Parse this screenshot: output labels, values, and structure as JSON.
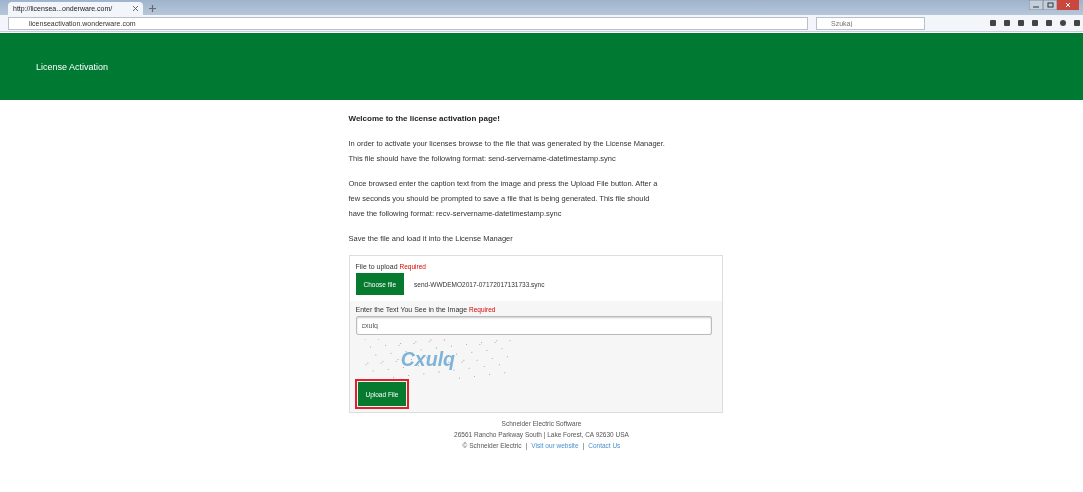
{
  "browser": {
    "tab": {
      "title": "http://licensea...onderware.com/",
      "selected": true
    },
    "url": "licenseactivation.wonderware.com",
    "search": {
      "placeholder": "Szukaj"
    }
  },
  "header": {
    "title": "License Activation"
  },
  "content": {
    "heading": "Welcome to the license activation page!",
    "paragraphs": [
      [
        "In order to activate your licenses browse to the file that was generated by the License Manager.",
        "This file should have the following format: send-servername-datetimestamp.sync"
      ],
      [
        "Once browsed enter the caption text from the image and press the Upload File button. After a",
        "few seconds you should be prompted to save a file that is being generated. This file should",
        "have the following format: recv-servername-datetimestamp.sync"
      ],
      [
        "Save the file and load it into the License Manager"
      ]
    ]
  },
  "form": {
    "file_label": "File to upload",
    "file_required": "Required",
    "choose_button": "Choose file",
    "file_name": "send-WWDEMO2017-07172017131733.sync",
    "captcha_label": "Enter the Text You See in the Image",
    "captcha_required": "Required",
    "captcha_value": "cxulq",
    "captcha_text": "Cxulq",
    "upload_button": "Upload File",
    "upload_highlighted": true
  },
  "footer": {
    "separator": "|",
    "company": "Schneider Electric Software",
    "address": "26561 Rancho Parkway South | Lake Forest, CA 92630 USA",
    "links": [
      {
        "kind": "text",
        "label": "© Schneider Electric"
      },
      {
        "kind": "link",
        "label": "Visit our website"
      },
      {
        "kind": "link",
        "label": "Contact Us"
      }
    ]
  }
}
